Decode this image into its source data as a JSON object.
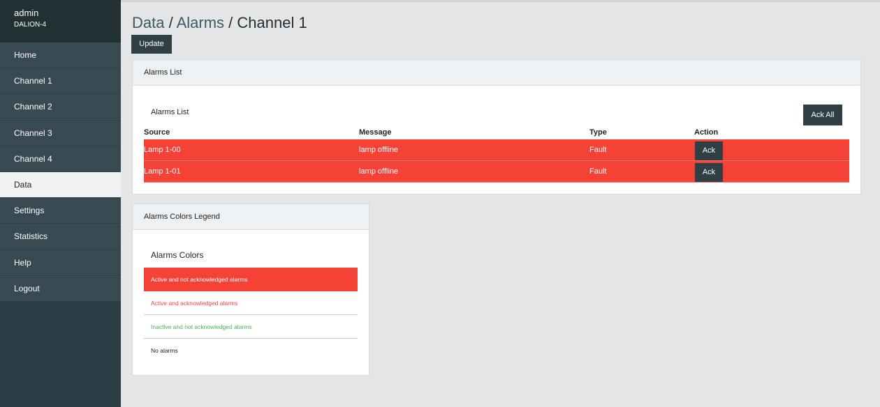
{
  "sidebar": {
    "user": "admin",
    "device": "DALION-4",
    "items": [
      {
        "label": "Home"
      },
      {
        "label": "Channel 1"
      },
      {
        "label": "Channel 2"
      },
      {
        "label": "Channel 3"
      },
      {
        "label": "Channel 4"
      },
      {
        "label": "Data"
      },
      {
        "label": "Settings"
      },
      {
        "label": "Statistics"
      },
      {
        "label": "Help"
      },
      {
        "label": "Logout"
      }
    ],
    "active": "Data"
  },
  "header": {
    "crumb1": "Data",
    "crumb2": "Alarms",
    "crumb3": "Channel 1",
    "sep": " / ",
    "update_label": "Update"
  },
  "alarms": {
    "panel_title": "Alarms List",
    "inner_title": "Alarms List",
    "ack_all_label": "Ack All",
    "columns": [
      "Source",
      "Message",
      "Type",
      "Action"
    ],
    "rows": [
      {
        "source": "Lamp 1-00",
        "message": "lamp offline",
        "type": "Fault",
        "action": "Ack"
      },
      {
        "source": "Lamp 1-01",
        "message": "lamp offline",
        "type": "Fault",
        "action": "Ack"
      }
    ],
    "row_color": "#f44336"
  },
  "legend": {
    "panel_title": "Alarms Colors Legend",
    "inner_title": "Alarms Colors",
    "items": [
      {
        "label": "Active and not acknowledged alarms",
        "color": "#f44336"
      },
      {
        "label": "Active and acknowledged alarms",
        "color": "#f44336"
      },
      {
        "label": "Inactive and not acknowledged alarms",
        "color": "#4caf50"
      },
      {
        "label": "No alarms",
        "color": "#222222"
      }
    ]
  }
}
